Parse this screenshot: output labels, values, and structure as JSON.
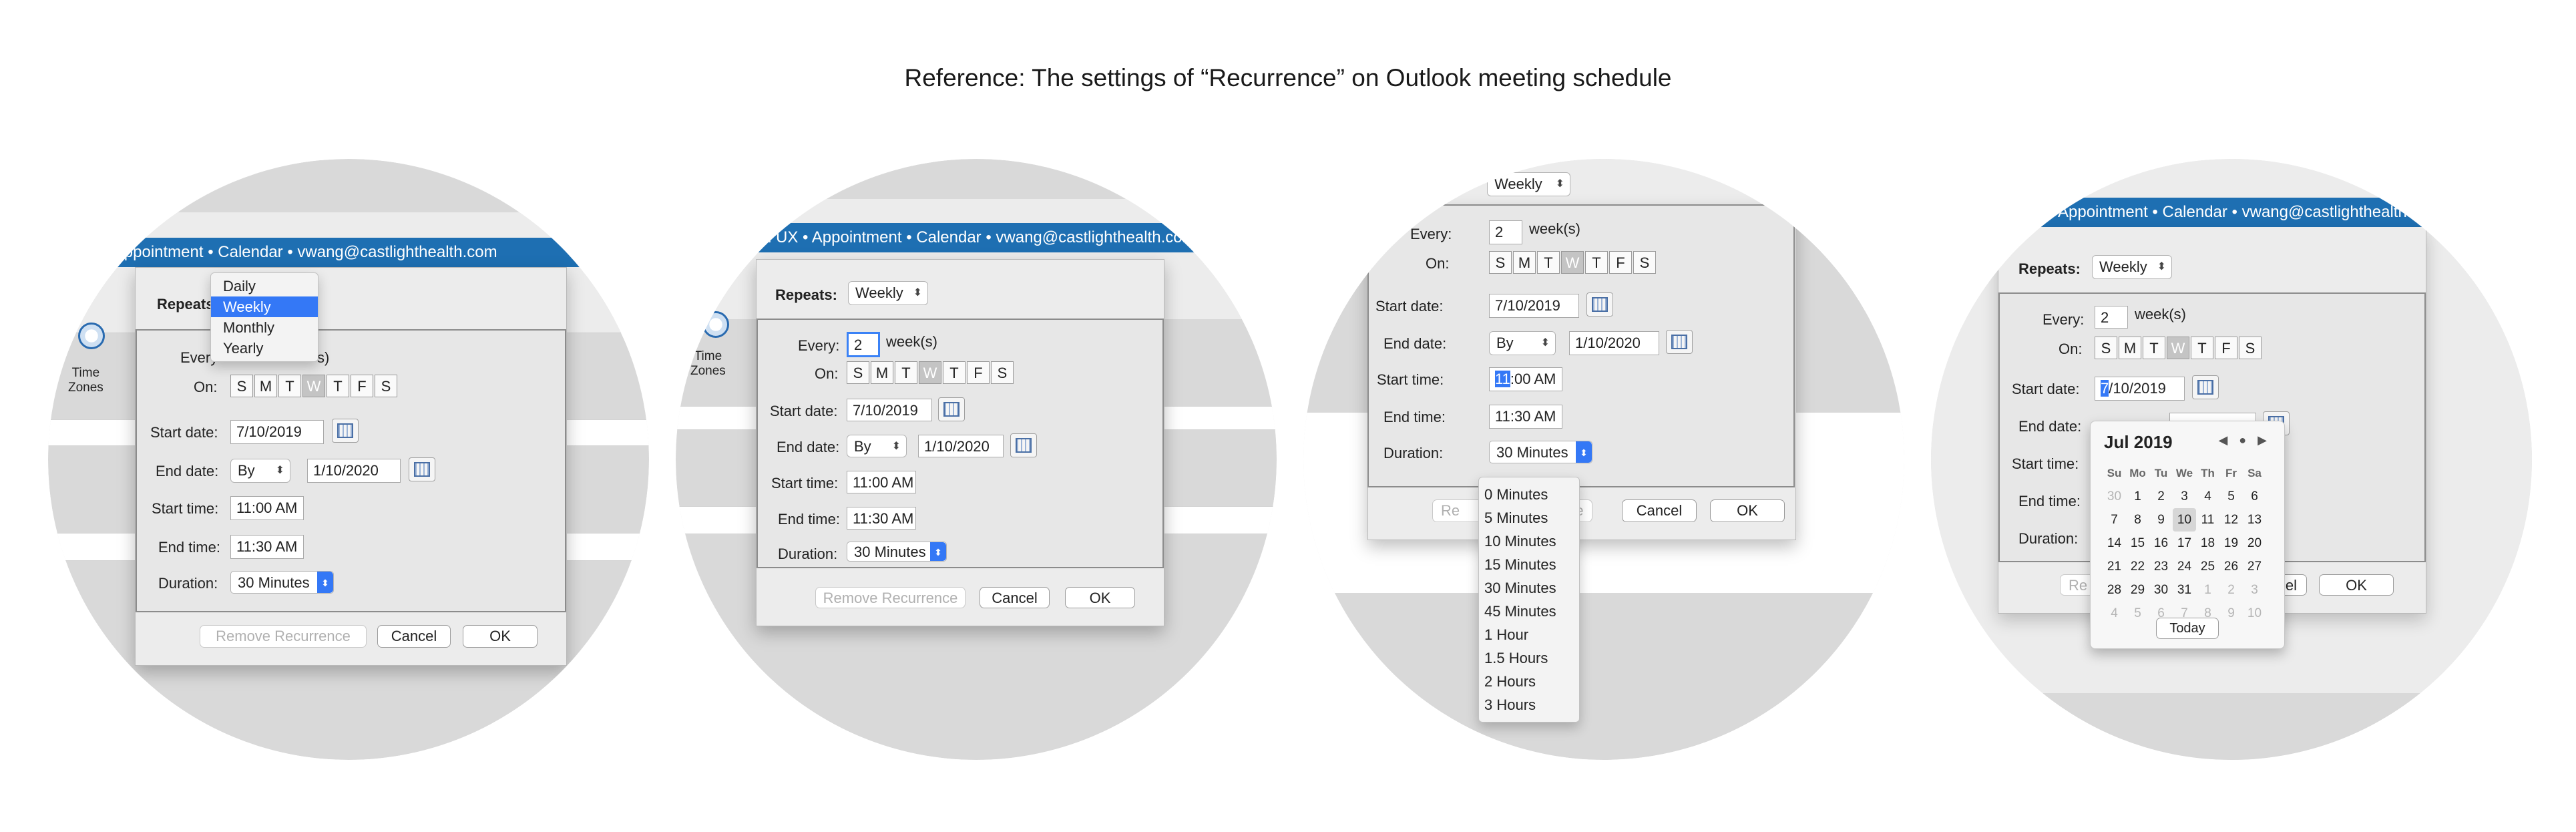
{
  "caption": "Reference: The settings of “Recurrence” on Outlook meeting schedule",
  "band_text": {
    "p1": "lth UX • Appointment • Calendar • vwang@castlighthealth.com",
    "p2": "h UX • Appointment • Calendar • vwang@castlighthealth.com",
    "p4": "Appointment • Calendar • vwang@castlighthealth.com"
  },
  "time_zones": {
    "line1": "Time",
    "line2": "Zones",
    "p1_line2": "Zones"
  },
  "labels": {
    "repeats": "Repeats:",
    "every": "Every:",
    "weeks": "week(s)",
    "on": "On:",
    "start_date": "Start date:",
    "end_date": "End date:",
    "start_time": "Start time:",
    "end_time": "End time:",
    "duration": "Duration:"
  },
  "values": {
    "repeats": "Weekly",
    "every": "2",
    "start_date": "7/10/2019",
    "end_by": "By",
    "end_date": "1/10/2020",
    "start_time": "11:00 AM",
    "end_time": "11:30 AM",
    "duration": "30 Minutes"
  },
  "weekdays": [
    "S",
    "M",
    "T",
    "W",
    "T",
    "F",
    "S"
  ],
  "weekday_selected_index": 3,
  "buttons": {
    "remove": "Remove Recurrence",
    "cancel": "Cancel",
    "ok": "OK"
  },
  "panel1": {
    "every_clip": "Every",
    "weeks_clip": "s)",
    "repeats_menu": [
      "Daily",
      "Weekly",
      "Monthly",
      "Yearly"
    ],
    "repeats_menu_selected": 1
  },
  "panel3": {
    "start_time_hl": "11",
    "start_time_rest": ":00 AM",
    "remove_clip_a": "Re",
    "remove_clip_b": "nce",
    "duration_options": [
      "0 Minutes",
      "5 Minutes",
      "10 Minutes",
      "15 Minutes",
      "30 Minutes",
      "45 Minutes",
      "1 Hour",
      "1.5 Hours",
      "2 Hours",
      "3 Hours"
    ]
  },
  "panel4": {
    "start_date_hl": "7",
    "start_date_rest": "/10/2019",
    "remove_clip": "Re",
    "cancel_clip": "cel",
    "calendar": {
      "month": "Jul 2019",
      "nav": "◀ ● ▶",
      "headers": [
        "Su",
        "Mo",
        "Tu",
        "We",
        "Th",
        "Fr",
        "Sa"
      ],
      "days": [
        "30",
        "1",
        "2",
        "3",
        "4",
        "5",
        "6",
        "7",
        "8",
        "9",
        "10",
        "11",
        "12",
        "13",
        "14",
        "15",
        "16",
        "17",
        "18",
        "19",
        "20",
        "21",
        "22",
        "23",
        "24",
        "25",
        "26",
        "27",
        "28",
        "29",
        "30",
        "31",
        "1",
        "2",
        "3",
        "4",
        "5",
        "6",
        "7",
        "8",
        "9",
        "10"
      ],
      "dim_indices": [
        0,
        32,
        33,
        34,
        35,
        36,
        37,
        38,
        39,
        40,
        41
      ],
      "current_index": 10,
      "today": "Today"
    }
  }
}
